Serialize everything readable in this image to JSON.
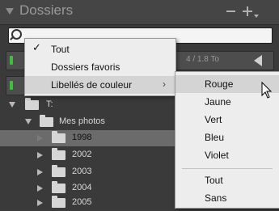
{
  "panel": {
    "title": "Dossiers",
    "search": {
      "value": "",
      "placeholder": ""
    }
  },
  "volumes": [
    {
      "size_text": "4 / 1.8 To"
    },
    {
      "size_text": ""
    }
  ],
  "tree": {
    "root": "T:",
    "parent": "Mes photos",
    "folders": [
      "1998",
      "2002",
      "2003",
      "2004",
      "2005"
    ]
  },
  "filter_menu": {
    "items": [
      {
        "label": "Tout",
        "checked": true
      },
      {
        "label": "Dossiers favoris"
      },
      {
        "label": "Libellés de couleur",
        "submenu_glyph": "›"
      }
    ]
  },
  "color_menu": {
    "items": [
      "Rouge",
      "Jaune",
      "Vert",
      "Bleu",
      "Violet",
      "Tout",
      "Sans"
    ],
    "highlighted": "Rouge"
  },
  "icons": [
    "search-icon",
    "collapse-icon",
    "add-icon",
    "check-icon",
    "submenu-arrow-icon",
    "eject-icon",
    "folder-icon",
    "cursor-icon"
  ]
}
